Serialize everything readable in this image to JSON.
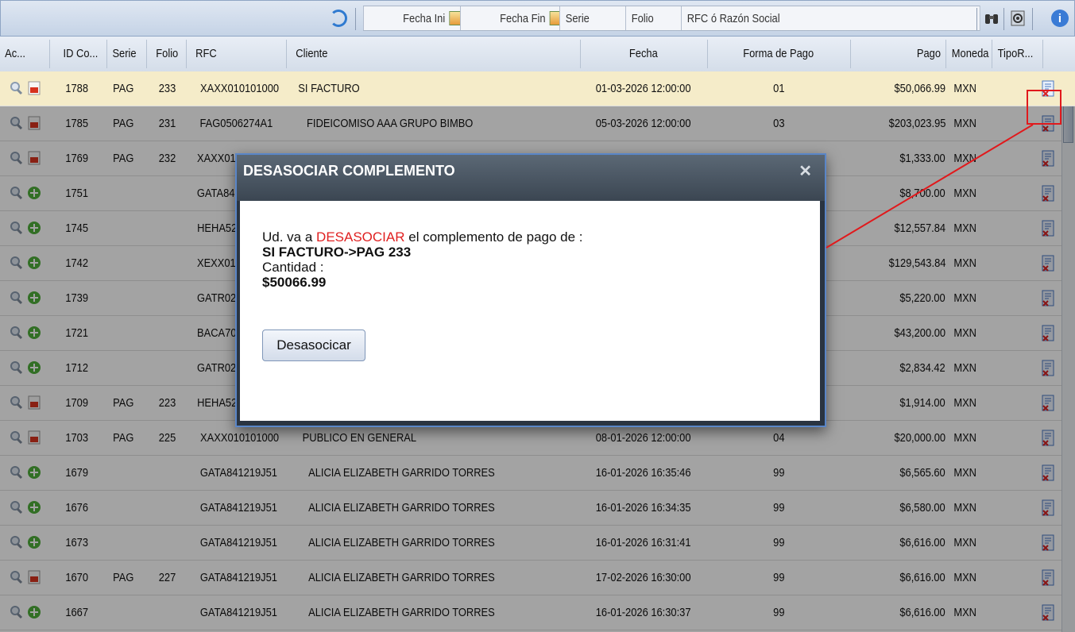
{
  "toolbar": {
    "fecha_ini_label": "Fecha Ini",
    "fecha_fin_label": "Fecha Fin",
    "serie_placeholder": "Serie",
    "folio_placeholder": "Folio",
    "rfc_placeholder": "RFC ó Razón Social"
  },
  "columns": {
    "acciones": "Ac...",
    "id": "ID Co...",
    "serie": "Serie",
    "folio": "Folio",
    "rfc": "RFC",
    "cliente": "Cliente",
    "fecha": "Fecha",
    "forma_pago": "Forma de Pago",
    "pago": "Pago",
    "moneda": "Moneda",
    "tipo": "TipoR..."
  },
  "rows": [
    {
      "id": "1788",
      "serie": "PAG",
      "folio": "233",
      "rfc": "XAXX010101000",
      "cliente": "SI FACTURO",
      "fecha": "01-03-2026 12:00:00",
      "forma": "01",
      "pago": "$50,066.99",
      "moneda": "MXN",
      "action": "pdf",
      "selected": true
    },
    {
      "id": "1785",
      "serie": "PAG",
      "folio": "231",
      "rfc": "FAG0506274A1",
      "cliente": "FIDEICOMISO AAA GRUPO BIMBO",
      "fecha": "05-03-2026 12:00:00",
      "forma": "03",
      "pago": "$203,023.95",
      "moneda": "MXN",
      "action": "pdf"
    },
    {
      "id": "1769",
      "serie": "PAG",
      "folio": "232",
      "rfc": "XAXX01",
      "cliente": "",
      "fecha": "",
      "forma": "",
      "pago": "$1,333.00",
      "moneda": "MXN",
      "action": "pdf"
    },
    {
      "id": "1751",
      "serie": "",
      "folio": "",
      "rfc": "GATA84",
      "cliente": "",
      "fecha": "",
      "forma": "",
      "pago": "$8,700.00",
      "moneda": "MXN",
      "action": "add"
    },
    {
      "id": "1745",
      "serie": "",
      "folio": "",
      "rfc": "HEHA52",
      "cliente": "",
      "fecha": "",
      "forma": "",
      "pago": "$12,557.84",
      "moneda": "MXN",
      "action": "add"
    },
    {
      "id": "1742",
      "serie": "",
      "folio": "",
      "rfc": "XEXX01",
      "cliente": "",
      "fecha": "",
      "forma": "",
      "pago": "$129,543.84",
      "moneda": "MXN",
      "action": "add"
    },
    {
      "id": "1739",
      "serie": "",
      "folio": "",
      "rfc": "GATR02",
      "cliente": "",
      "fecha": "",
      "forma": "",
      "pago": "$5,220.00",
      "moneda": "MXN",
      "action": "add"
    },
    {
      "id": "1721",
      "serie": "",
      "folio": "",
      "rfc": "BACA70",
      "cliente": "",
      "fecha": "",
      "forma": "",
      "pago": "$43,200.00",
      "moneda": "MXN",
      "action": "add"
    },
    {
      "id": "1712",
      "serie": "",
      "folio": "",
      "rfc": "GATR02",
      "cliente": "",
      "fecha": "",
      "forma": "",
      "pago": "$2,834.42",
      "moneda": "MXN",
      "action": "add"
    },
    {
      "id": "1709",
      "serie": "PAG",
      "folio": "223",
      "rfc": "HEHA52",
      "cliente": "",
      "fecha": "",
      "forma": "",
      "pago": "$1,914.00",
      "moneda": "MXN",
      "action": "pdf"
    },
    {
      "id": "1703",
      "serie": "PAG",
      "folio": "225",
      "rfc": "XAXX010101000",
      "cliente": "PUBLICO EN GENERAL",
      "fecha": "08-01-2026 12:00:00",
      "forma": "04",
      "pago": "$20,000.00",
      "moneda": "MXN",
      "action": "pdf"
    },
    {
      "id": "1679",
      "serie": "",
      "folio": "",
      "rfc": "GATA841219J51",
      "cliente": "ALICIA ELIZABETH GARRIDO TORRES",
      "fecha": "16-01-2026 16:35:46",
      "forma": "99",
      "pago": "$6,565.60",
      "moneda": "MXN",
      "action": "add"
    },
    {
      "id": "1676",
      "serie": "",
      "folio": "",
      "rfc": "GATA841219J51",
      "cliente": "ALICIA ELIZABETH GARRIDO TORRES",
      "fecha": "16-01-2026 16:34:35",
      "forma": "99",
      "pago": "$6,580.00",
      "moneda": "MXN",
      "action": "add"
    },
    {
      "id": "1673",
      "serie": "",
      "folio": "",
      "rfc": "GATA841219J51",
      "cliente": "ALICIA ELIZABETH GARRIDO TORRES",
      "fecha": "16-01-2026 16:31:41",
      "forma": "99",
      "pago": "$6,616.00",
      "moneda": "MXN",
      "action": "add"
    },
    {
      "id": "1670",
      "serie": "PAG",
      "folio": "227",
      "rfc": "GATA841219J51",
      "cliente": "ALICIA ELIZABETH GARRIDO TORRES",
      "fecha": "17-02-2026 16:30:00",
      "forma": "99",
      "pago": "$6,616.00",
      "moneda": "MXN",
      "action": "pdf"
    },
    {
      "id": "1667",
      "serie": "",
      "folio": "",
      "rfc": "GATA841219J51",
      "cliente": "ALICIA ELIZABETH GARRIDO TORRES",
      "fecha": "16-01-2026 16:30:37",
      "forma": "99",
      "pago": "$6,616.00",
      "moneda": "MXN",
      "action": "add"
    }
  ],
  "dialog": {
    "title": "DESASOCIAR COMPLEMENTO",
    "close": "✕",
    "line1_pre": "Ud. va a ",
    "line1_red": "DESASOCIAR",
    "line1_post": " el complemento de pago de :",
    "line2": "SI FACTURO->PAG 233",
    "line3": "Cantidad :",
    "line4": "$50066.99",
    "button": "Desasocicar"
  },
  "colors": {
    "highlight": "#e1191c",
    "selected_row": "#f5ecc9",
    "accent_red_text": "#e02020"
  },
  "icons": {
    "toolbar": [
      "refresh-icon",
      "calendar-icon",
      "binoculars-icon",
      "gear-icon",
      "info-icon"
    ],
    "row_actions": [
      "magnifier-icon",
      "pdf-icon",
      "add-icon",
      "cancel-document-icon"
    ]
  }
}
